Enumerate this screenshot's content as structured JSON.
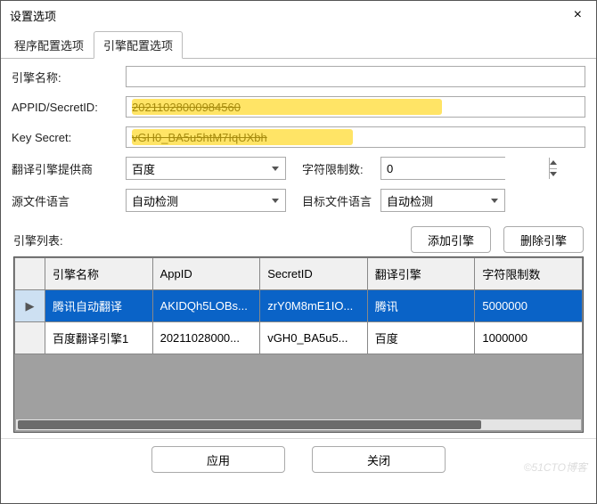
{
  "window": {
    "title": "设置选项",
    "close_icon": "×"
  },
  "tabs": {
    "t0": "程序配置选项",
    "t1": "引擎配置选项"
  },
  "labels": {
    "engine_name": "引擎名称:",
    "appid": "APPID/SecretID:",
    "keysecret": "Key Secret:",
    "provider": "翻译引擎提供商",
    "char_limit": "字符限制数:",
    "src_lang": "源文件语言",
    "tgt_lang": "目标文件语言",
    "engine_list": "引擎列表:"
  },
  "fields": {
    "engine_name": "",
    "appid": "20211028000984560",
    "keysecret": "vGH0_BA5u5htM7IqUXbh",
    "provider": "百度",
    "char_limit": "0",
    "src_lang": "自动检测",
    "tgt_lang": "自动检测"
  },
  "buttons": {
    "add_engine": "添加引擎",
    "del_engine": "删除引擎",
    "apply": "应用",
    "close": "关闭"
  },
  "grid": {
    "headers": {
      "c0": "引擎名称",
      "c1": "AppID",
      "c2": "SecretID",
      "c3": "翻译引擎",
      "c4": "字符限制数"
    },
    "rows": [
      {
        "indicator": "▶",
        "c0": "腾讯自动翻译",
        "c1": "AKIDQh5LOBs...",
        "c2": "zrY0M8mE1IO...",
        "c3": "腾讯",
        "c4": "5000000",
        "selected": true
      },
      {
        "indicator": "",
        "c0": "百度翻译引擎1",
        "c1": "20211028000...",
        "c2": "vGH0_BA5u5...",
        "c3": "百度",
        "c4": "1000000",
        "selected": false
      }
    ]
  },
  "watermark": "©51CTO博客"
}
